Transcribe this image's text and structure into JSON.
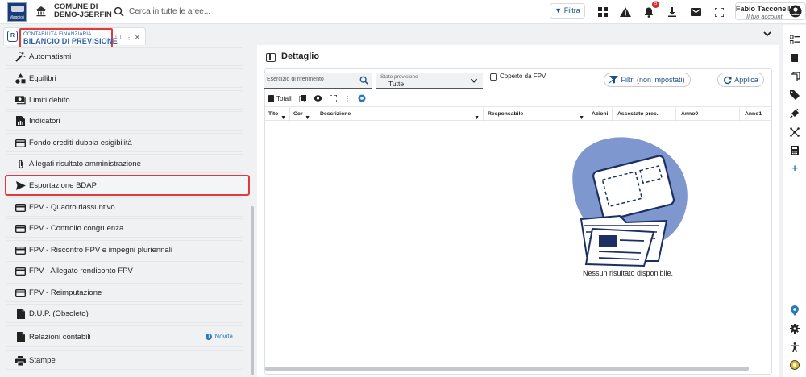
{
  "topbar": {
    "org_line1": "COMUNE DI",
    "org_line2": "DEMO-JSERFIN",
    "search_placeholder": "Cerca in tutte le aree...",
    "filtra_label": "Filtra",
    "notifications_count": "5",
    "user_name": "Fabio Tacconelli",
    "user_sub": "Il tuo account"
  },
  "tab": {
    "subtitle": "CONTABILITÀ FINANZIARIA",
    "title": "BILANCIO DI PREVISIONE"
  },
  "menu": {
    "items": [
      {
        "label": "Automatismi",
        "icon": "wand-icon"
      },
      {
        "label": "Equilibri",
        "icon": "shapes-icon"
      },
      {
        "label": "Limiti debito",
        "icon": "money-icon"
      },
      {
        "label": "Indicatori",
        "icon": "chart-file-icon"
      },
      {
        "label": "Fondo crediti dubbia esigibilità",
        "icon": "card-icon"
      },
      {
        "label": "Allegati risultato amministrazione",
        "icon": "paperclip-icon"
      },
      {
        "label": "Esportazione BDAP",
        "icon": "send-icon",
        "highlighted": true
      },
      {
        "label": "FPV - Quadro riassuntivo",
        "icon": "card-icon"
      },
      {
        "label": "FPV - Controllo congruenza",
        "icon": "card-icon"
      },
      {
        "label": "FPV - Riscontro FPV e impegni pluriennali",
        "icon": "card-icon"
      },
      {
        "label": "FPV - Allegato rendiconto FPV",
        "icon": "card-icon"
      },
      {
        "label": "FPV - Reimputazione",
        "icon": "card-icon"
      },
      {
        "label": "D.U.P. (Obsoleto)",
        "icon": "file-icon"
      },
      {
        "label": "Relazioni contabili",
        "icon": "file-icon",
        "badge": "Novità"
      },
      {
        "label": "Stampe",
        "icon": "printer-icon"
      }
    ]
  },
  "panel": {
    "title": "Dettaglio",
    "esercizio_placeholder": "Esercizio di riferimento",
    "stato_caption": "Stato previsione",
    "stato_value": "Tutte",
    "fpv_label": "Coperto da FPV",
    "filtri_label": "Filtri (non impostati)",
    "applica_label": "Applica",
    "totali_label": "Totali",
    "columns": [
      "Tito",
      "Cor",
      "Descrizione",
      "Responsabile",
      "Azioni",
      "Assestato prec.",
      "Anno0",
      "Anno1"
    ],
    "empty_message": "Nessun risultato disponibile."
  },
  "colors": {
    "accent": "#1f4f8a",
    "highlight": "#e03a3a",
    "illustration": "#7e97cf"
  }
}
